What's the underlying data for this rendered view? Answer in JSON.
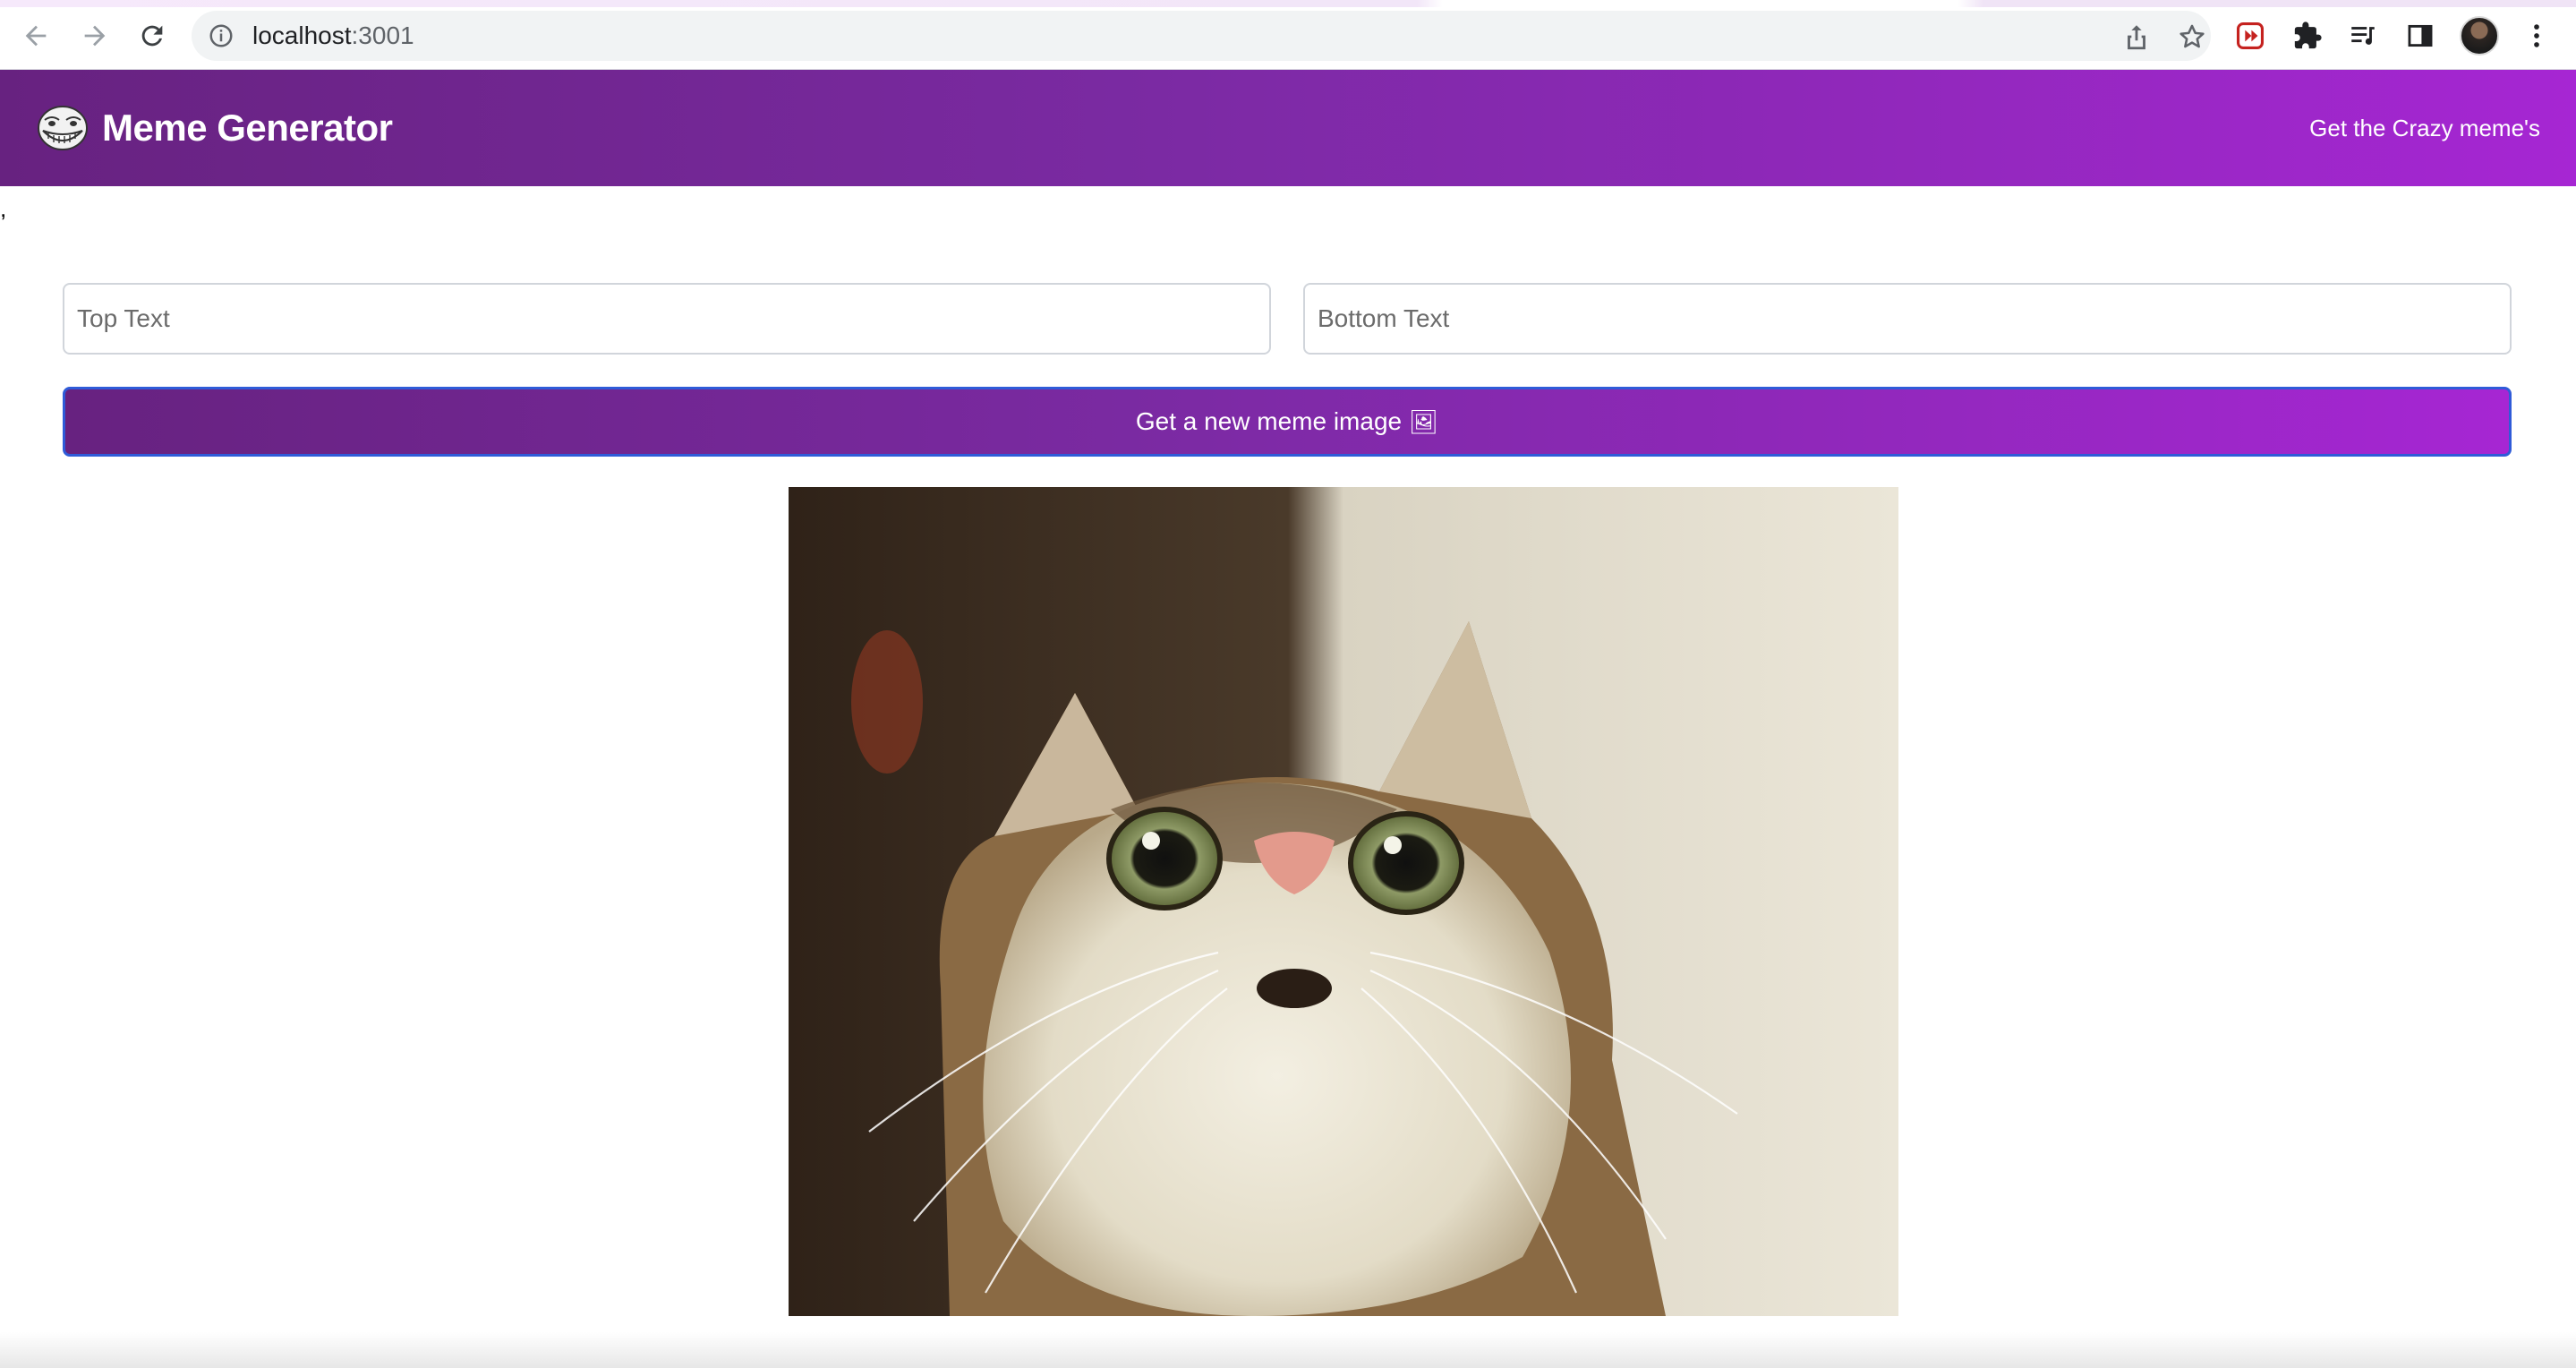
{
  "browser": {
    "url_host": "localhost",
    "url_port": ":3001",
    "icons": {
      "back": "arrow-left-icon",
      "forward": "arrow-right-icon",
      "reload": "reload-icon",
      "site_info": "info-icon",
      "share": "share-icon",
      "bookmark": "star-icon",
      "extension_red": "video-extension-icon",
      "extensions": "puzzle-icon",
      "media": "media-playlist-icon",
      "side_panel": "side-panel-icon",
      "menu": "kebab-menu-icon"
    }
  },
  "header": {
    "logo": "troll-face-logo",
    "title": "Meme Generator",
    "tagline": "Get the Crazy meme's",
    "gradient": [
      "#672280",
      "#a626d3"
    ]
  },
  "stray_text": ",",
  "form": {
    "top_placeholder": "Top Text",
    "bottom_placeholder": "Bottom Text",
    "top_value": "",
    "bottom_value": "",
    "button_label": "Get a new meme image",
    "button_emoji": "🖼"
  },
  "meme": {
    "description_icon": "surprised-cat-image"
  }
}
